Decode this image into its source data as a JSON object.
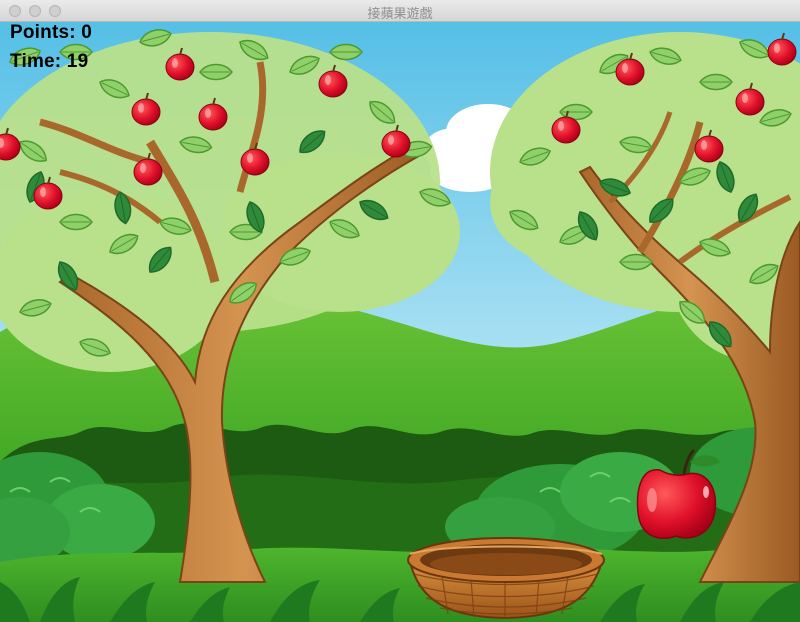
{
  "window": {
    "title": "接蘋果遊戲"
  },
  "hud": {
    "points_text": "Points: 0",
    "time_text": "Time: 19"
  },
  "game": {
    "points": 0,
    "time_remaining": 19,
    "falling_apple_count": 1
  },
  "colors": {
    "sky_top": "#5ec3e6",
    "hill_green": "#4fb52b",
    "apple_red": "#e0102a",
    "basket_brown": "#b8691f"
  }
}
